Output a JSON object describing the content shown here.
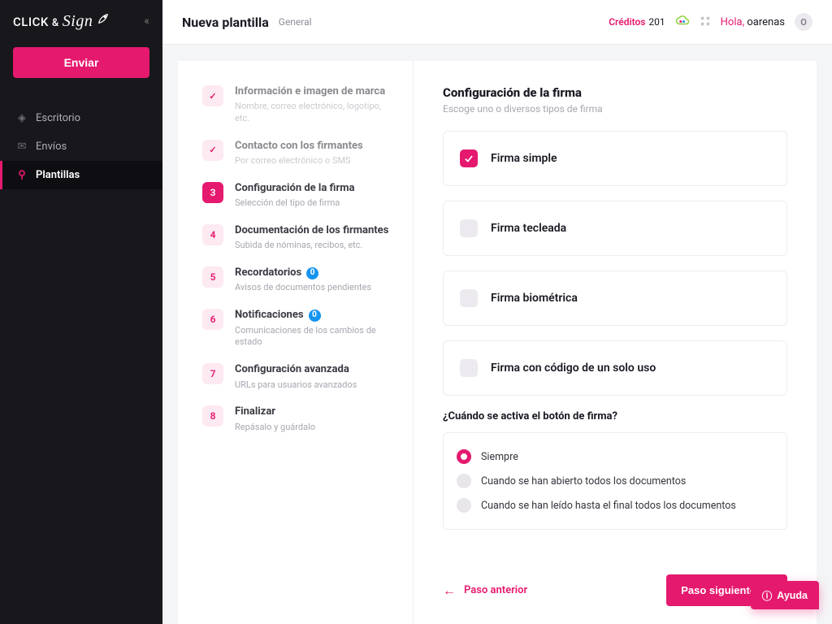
{
  "brand": {
    "click": "CLICK",
    "amp": "&",
    "sign": "Sign"
  },
  "sidebar": {
    "send_label": "Enviar",
    "items": [
      {
        "icon": "◈",
        "label": "Escritorio"
      },
      {
        "icon": "✉",
        "label": "Envíos"
      },
      {
        "icon": "⚲",
        "label": "Plantillas"
      }
    ]
  },
  "topbar": {
    "title": "Nueva plantilla",
    "subtitle": "General",
    "credits_label": "Créditos",
    "credits_value": "201",
    "greet_hi": "Hola,",
    "greet_user": "oarenas",
    "avatar_letter": "O"
  },
  "steps": [
    {
      "badge": "✓",
      "state": "done",
      "title": "Información e imagen de marca",
      "sub": "Nombre, correo electrónico, logotipo, etc.",
      "pill": null
    },
    {
      "badge": "✓",
      "state": "done",
      "title": "Contacto con los firmantes",
      "sub": "Por correo electrónico o SMS",
      "pill": null
    },
    {
      "badge": "3",
      "state": "current",
      "title": "Configuración de la firma",
      "sub": "Selección del tipo de firma",
      "pill": null
    },
    {
      "badge": "4",
      "state": "pending",
      "title": "Documentación de los firmantes",
      "sub": "Subida de nóminas, recibos, etc.",
      "pill": null
    },
    {
      "badge": "5",
      "state": "pending",
      "title": "Recordatorios",
      "sub": "Avisos de documentos pendientes",
      "pill": "0"
    },
    {
      "badge": "6",
      "state": "pending",
      "title": "Notificaciones",
      "sub": "Comunicaciones de los cambios de estado",
      "pill": "0"
    },
    {
      "badge": "7",
      "state": "pending",
      "title": "Configuración avanzada",
      "sub": "URLs para usuarios avanzados",
      "pill": null
    },
    {
      "badge": "8",
      "state": "pending",
      "title": "Finalizar",
      "sub": "Repásalo y guárdalo",
      "pill": null
    }
  ],
  "config": {
    "title": "Configuración de la firma",
    "subtitle": "Escoge uno o diversos tipos de firma",
    "options": [
      {
        "label": "Firma simple",
        "checked": true
      },
      {
        "label": "Firma tecleada",
        "checked": false
      },
      {
        "label": "Firma biométrica",
        "checked": false
      },
      {
        "label": "Firma con código de un solo uso",
        "checked": false
      }
    ],
    "question": "¿Cuándo se activa el botón de firma?",
    "radios": [
      {
        "label": "Siempre",
        "selected": true
      },
      {
        "label": "Cuando se han abierto todos los documentos",
        "selected": false
      },
      {
        "label": "Cuando se han leído hasta el final todos los documentos",
        "selected": false
      }
    ]
  },
  "footer": {
    "prev": "Paso anterior",
    "next": "Paso siguiente"
  },
  "help": "Ayuda",
  "icons": {
    "check": "✓",
    "arrow_right": "→",
    "arrow_left": "←",
    "help": "?"
  }
}
